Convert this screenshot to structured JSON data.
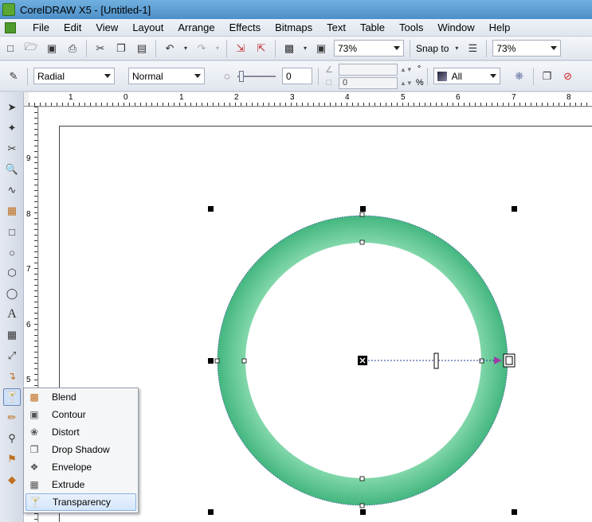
{
  "window": {
    "title": "CorelDRAW X5 - [Untitled-1]"
  },
  "menu": [
    "File",
    "Edit",
    "View",
    "Layout",
    "Arrange",
    "Effects",
    "Bitmaps",
    "Text",
    "Table",
    "Tools",
    "Window",
    "Help"
  ],
  "standard_toolbar": {
    "zoom_level": "73%",
    "snap_to_label": "Snap to",
    "zoom_level_2": "73%"
  },
  "property_bar": {
    "transparency_type": "Radial",
    "merge_mode": "Normal",
    "transparency_value": "0",
    "angle_value": "0",
    "degree_symbol": "°",
    "percent_symbol": "%",
    "target": "All"
  },
  "ruler_top": [
    "1",
    "0",
    "1",
    "2",
    "3",
    "4",
    "5",
    "6",
    "7",
    "8"
  ],
  "ruler_left": [
    "9",
    "8",
    "7",
    "6",
    "5"
  ],
  "flyout": {
    "items": [
      {
        "label": "Blend",
        "icon": "blend-icon",
        "selected": false
      },
      {
        "label": "Contour",
        "icon": "contour-icon",
        "selected": false
      },
      {
        "label": "Distort",
        "icon": "distort-icon",
        "selected": false
      },
      {
        "label": "Drop Shadow",
        "icon": "drop-shadow-icon",
        "selected": false
      },
      {
        "label": "Envelope",
        "icon": "envelope-icon",
        "selected": false
      },
      {
        "label": "Extrude",
        "icon": "extrude-icon",
        "selected": false
      },
      {
        "label": "Transparency",
        "icon": "transparency-icon",
        "selected": true
      }
    ]
  },
  "colors": {
    "ring_green": "#4fc08a",
    "ring_green_light": "#7fd6a8",
    "handle_arrow": "#9b3fa8",
    "selection_accent": "#cfe0f7"
  }
}
